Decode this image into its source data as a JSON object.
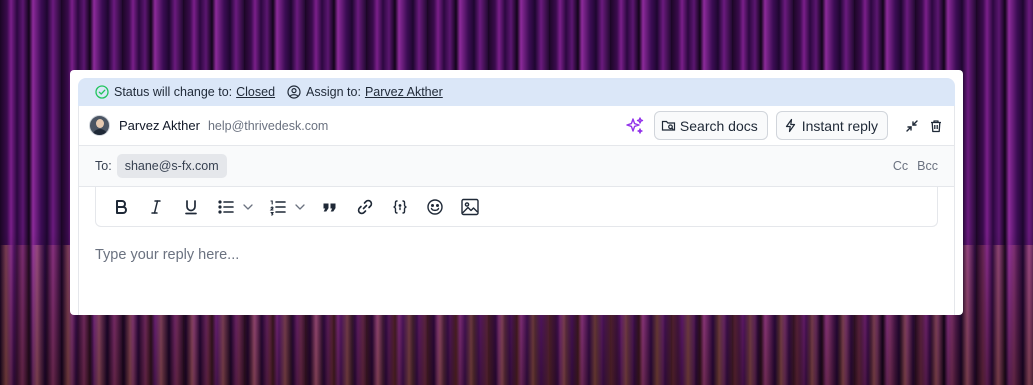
{
  "status": {
    "status_prefix": "Status will change to:",
    "status_value": "Closed",
    "assign_prefix": "Assign to:",
    "assign_value": "Parvez Akther"
  },
  "from": {
    "name": "Parvez Akther",
    "email": "help@thrivedesk.com"
  },
  "actions": {
    "search_docs": "Search docs",
    "instant_reply": "Instant reply"
  },
  "to": {
    "label": "To:",
    "recipient": "shane@s-fx.com",
    "cc": "Cc",
    "bcc": "Bcc"
  },
  "editor": {
    "placeholder": "Type your reply here..."
  },
  "colors": {
    "status_bar": "#dbe7f8",
    "ai_accent": "#9333ea",
    "success": "#22c55e"
  }
}
